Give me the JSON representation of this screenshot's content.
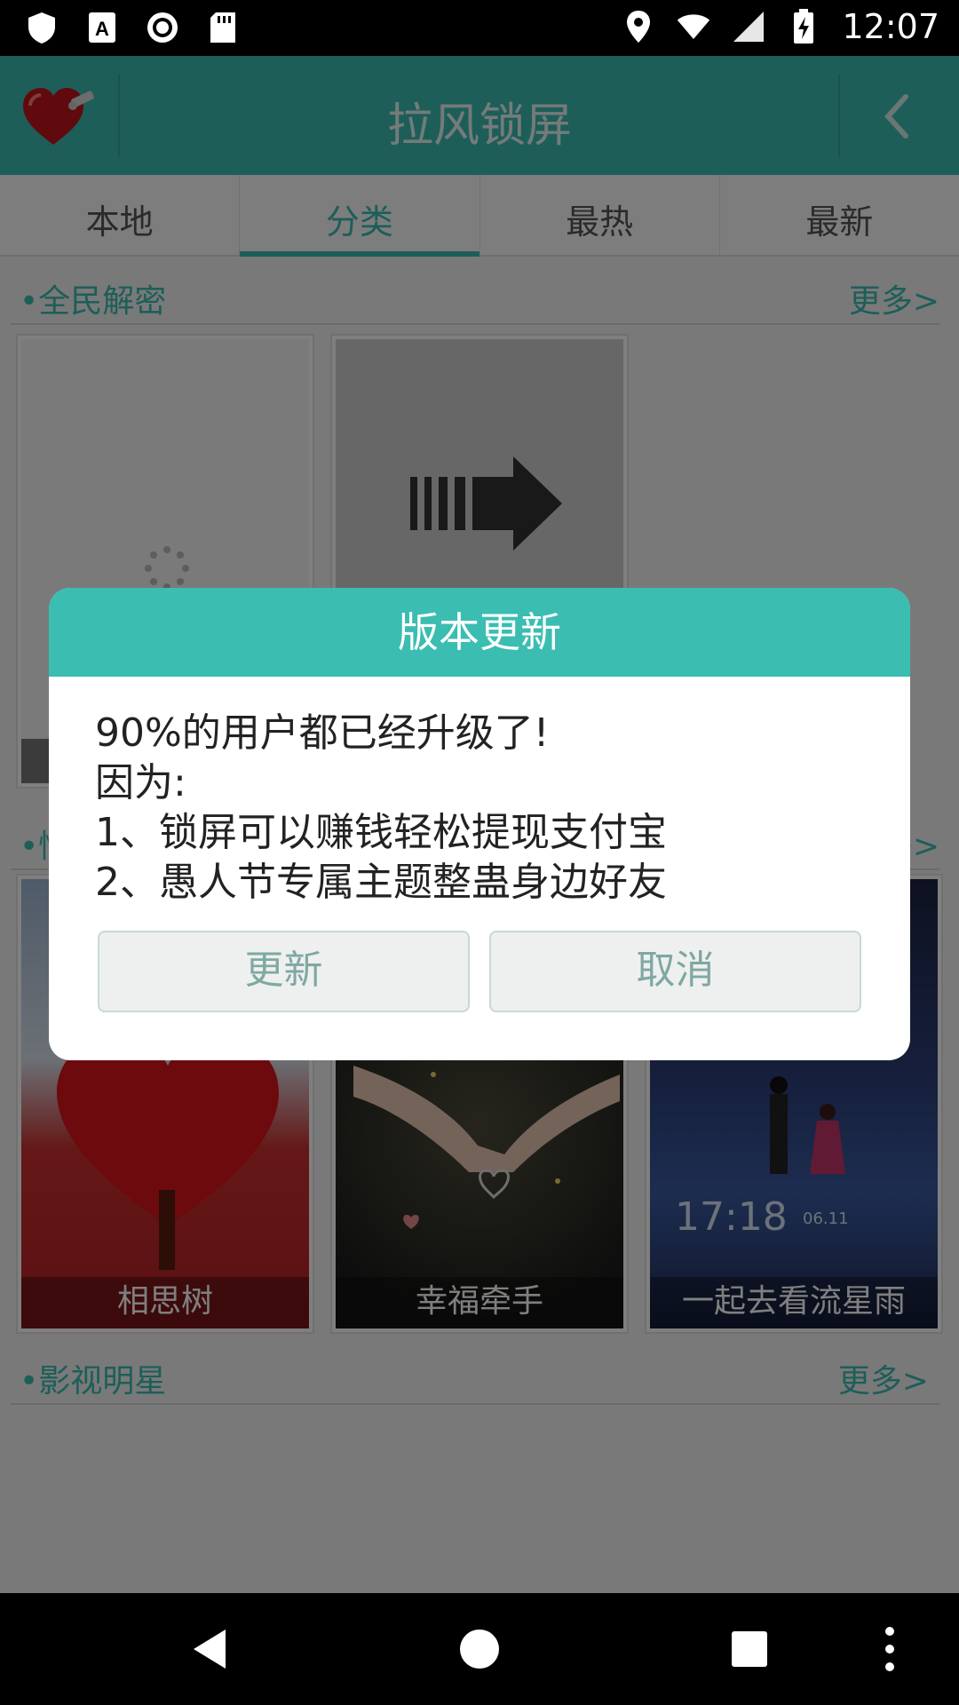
{
  "status_bar": {
    "time": "12:07",
    "icons": [
      "shield-icon",
      "a11y-icon",
      "record-icon",
      "sdcard-icon",
      "location-icon",
      "wifi-icon",
      "signal-icon",
      "battery-charging-icon"
    ]
  },
  "header": {
    "title": "拉风锁屏",
    "accent": "#3bbdb2"
  },
  "tabs": [
    {
      "label": "本地",
      "active": false
    },
    {
      "label": "分类",
      "active": true
    },
    {
      "label": "最热",
      "active": false
    },
    {
      "label": "最新",
      "active": false
    }
  ],
  "sections": [
    {
      "name": "•全民解密",
      "more": "更多>"
    },
    {
      "name": "•情",
      "more": "多>"
    },
    {
      "name": "•影视明星",
      "more": "更多>"
    }
  ],
  "cards_row2": [
    {
      "caption": "相思树"
    },
    {
      "caption": "幸福牵手"
    },
    {
      "caption": "一起去看流星雨"
    }
  ],
  "card_extra_text": {
    "clock": "17:18",
    "date": "06.11"
  },
  "dialog": {
    "title": "版本更新",
    "lines": [
      "90%的用户都已经升级了!",
      "因为:",
      "1、锁屏可以赚钱轻松提现支付宝",
      "2、愚人节专属主题整蛊身边好友"
    ],
    "update_label": "更新",
    "cancel_label": "取消"
  }
}
